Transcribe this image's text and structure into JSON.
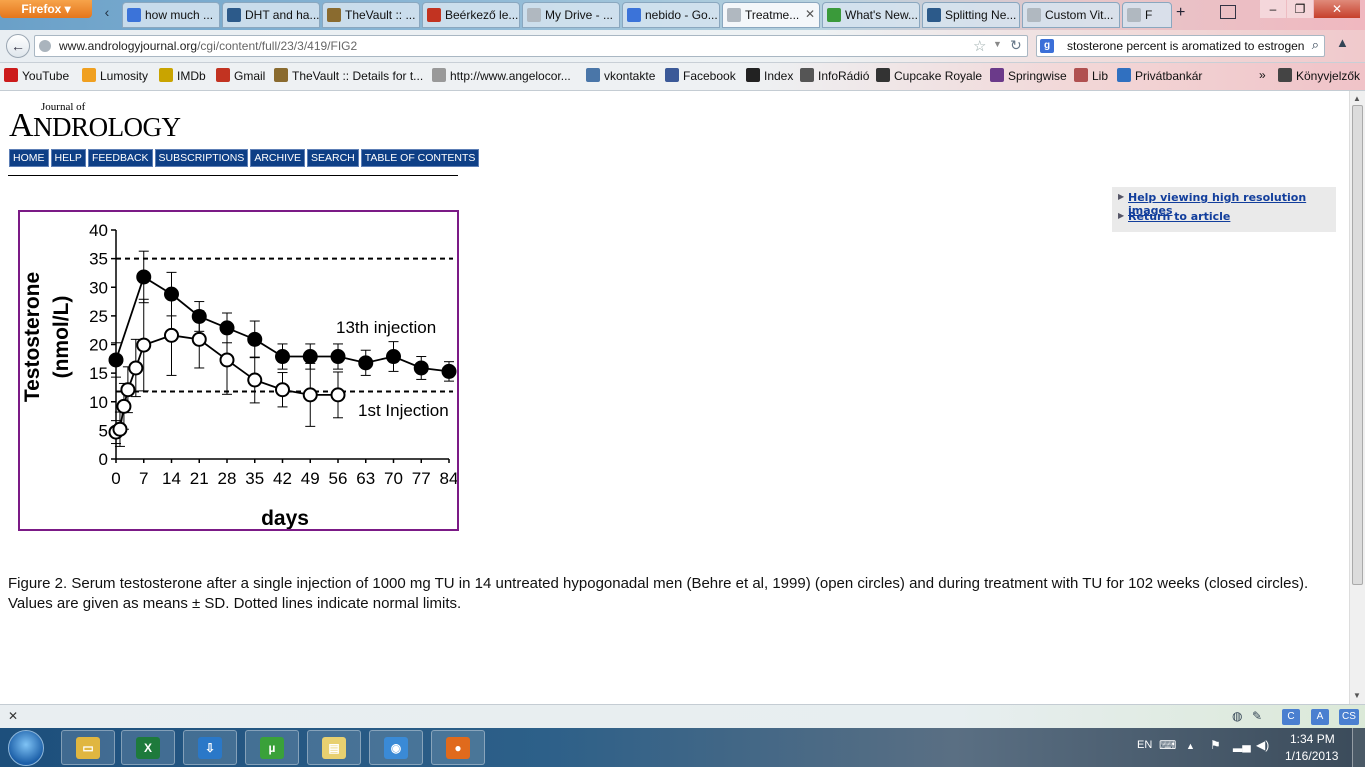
{
  "browser": {
    "app_button": "Firefox",
    "tabs": [
      {
        "label": "how much ...",
        "icon": "google-icon",
        "active": false
      },
      {
        "label": "DHT and ha...",
        "icon": "bookmark-icon",
        "active": false
      },
      {
        "label": "TheVault :: ...",
        "icon": "thevault-icon",
        "active": false
      },
      {
        "label": "Beérkező le...",
        "icon": "gmail-icon",
        "active": false
      },
      {
        "label": "My Drive - ...",
        "icon": "page-icon",
        "active": false
      },
      {
        "label": "nebido - Go...",
        "icon": "docs-icon",
        "active": false
      },
      {
        "label": "Treatme...",
        "icon": "page-icon",
        "active": true
      },
      {
        "label": "What's New...",
        "icon": "green-icon",
        "active": false
      },
      {
        "label": "Splitting Ne...",
        "icon": "bookmark-icon",
        "active": false
      },
      {
        "label": "Custom Vit...",
        "icon": "page-icon",
        "active": false
      },
      {
        "label": "F",
        "icon": "page-icon",
        "active": false
      }
    ],
    "url_host": "www.andrologyjournal.org",
    "url_path": "/cgi/content/full/23/3/419/FIG2",
    "search_query": "stosterone percent is aromatized to estrogen",
    "bookmarks": [
      {
        "label": "YouTube",
        "icon": "youtube-icon",
        "color": "#cc1b1b"
      },
      {
        "label": "Lumosity",
        "icon": "lumosity-icon",
        "color": "#f0a020"
      },
      {
        "label": "IMDb",
        "icon": "imdb-icon",
        "color": "#c9a400"
      },
      {
        "label": "Gmail",
        "icon": "gmail-icon",
        "color": "#c23321"
      },
      {
        "label": "TheVault :: Details for t...",
        "icon": "thevault-icon",
        "color": "#8a6b2f"
      },
      {
        "label": "http://www.angelocor...",
        "icon": "page-icon",
        "color": "#999999"
      },
      {
        "label": "vkontakte",
        "icon": "vk-icon",
        "color": "#4a76a8"
      },
      {
        "label": "Facebook",
        "icon": "facebook-icon",
        "color": "#3b5998"
      },
      {
        "label": "Index",
        "icon": "index-icon",
        "color": "#222222"
      },
      {
        "label": "InfoRádió",
        "icon": "inforadio-icon",
        "color": "#555555"
      },
      {
        "label": "Cupcake Royale",
        "icon": "cupcake-icon",
        "color": "#333333"
      },
      {
        "label": "Springwise",
        "icon": "springwise-icon",
        "color": "#6b3a8a"
      },
      {
        "label": "Lib",
        "icon": "lib-icon",
        "color": "#b05050"
      },
      {
        "label": "Privátbankár",
        "icon": "privatbankar-icon",
        "color": "#3070c0"
      },
      {
        "label": "»",
        "icon": "",
        "color": ""
      },
      {
        "label": "Könyvjelzők",
        "icon": "bookmarks-menu-icon",
        "color": "#444444"
      }
    ]
  },
  "page": {
    "journal_of": "Journal of",
    "journal_initial": "A",
    "journal_rest": "NDROLOGY",
    "nav": [
      "HOME",
      "HELP",
      "FEEDBACK",
      "SUBSCRIPTIONS",
      "ARCHIVE",
      "SEARCH",
      "TABLE OF CONTENTS"
    ],
    "help_links": [
      "Help viewing high resolution images",
      "Return to article"
    ],
    "caption": "Figure 2. Serum testosterone after a single injection of 1000 mg TU in 14 untreated hypogonadal men (Behre et al, 1999) (open circles) and during treatment with TU for 102 weeks (closed circles). Values are given as means ± SD. Dotted lines indicate normal limits."
  },
  "chart_data": {
    "type": "line",
    "title": "",
    "xlabel": "days",
    "ylabel": "Testosterone (nmol/L)",
    "xlim": [
      0,
      84
    ],
    "ylim": [
      0,
      40
    ],
    "xticks": [
      0,
      7,
      14,
      21,
      28,
      35,
      42,
      49,
      56,
      63,
      70,
      77,
      84
    ],
    "yticks": [
      0,
      5,
      10,
      15,
      20,
      25,
      30,
      35,
      40
    ],
    "reference_lines": [
      35,
      11.8
    ],
    "series": [
      {
        "name": "13th injection",
        "marker": "filled-circle",
        "x": [
          0,
          7,
          14,
          21,
          28,
          35,
          42,
          49,
          56,
          63,
          70,
          77,
          84
        ],
        "y": [
          17.3,
          31.8,
          28.8,
          24.9,
          22.9,
          20.9,
          17.9,
          17.9,
          17.9,
          16.8,
          17.9,
          15.9,
          15.3
        ],
        "sd": [
          3,
          4.5,
          3.8,
          2.6,
          2.6,
          3.2,
          2.2,
          2.2,
          2.2,
          2.2,
          2.6,
          2,
          1.7
        ]
      },
      {
        "name": "1st Injection",
        "marker": "open-circle",
        "x": [
          0,
          1,
          2,
          3,
          5,
          7,
          14,
          21,
          28,
          35,
          42,
          49,
          56
        ],
        "y": [
          4.7,
          5.2,
          9.2,
          12.1,
          15.9,
          19.9,
          21.6,
          20.9,
          17.3,
          13.8,
          12.1,
          11.2,
          11.2
        ],
        "sd": [
          2,
          3,
          4,
          4,
          5,
          8,
          7,
          5,
          6,
          4,
          3,
          5.5,
          4
        ]
      }
    ],
    "annotations": [
      "13th injection",
      "1st Injection"
    ],
    "frame_color": "#7b1a86"
  },
  "addon_bar": {
    "buttons": [
      "C",
      "A",
      "CS"
    ]
  },
  "taskbar": {
    "apps": [
      {
        "name": "explorer",
        "icon": "folder-icon",
        "color": "#e0b640"
      },
      {
        "name": "excel",
        "icon": "excel-icon",
        "color": "#1e7a3c"
      },
      {
        "name": "app-blue",
        "icon": "download-icon",
        "color": "#2a78c8"
      },
      {
        "name": "utorrent",
        "icon": "utorrent-icon",
        "color": "#3aa13a"
      },
      {
        "name": "notes",
        "icon": "notes-icon",
        "color": "#e8d070"
      },
      {
        "name": "dbs",
        "icon": "dbs-icon",
        "color": "#3a8ad6"
      },
      {
        "name": "firefox",
        "icon": "firefox-icon",
        "color": "#e06a1c"
      }
    ],
    "language": "EN",
    "time": "1:34 PM",
    "date": "1/16/2013"
  }
}
